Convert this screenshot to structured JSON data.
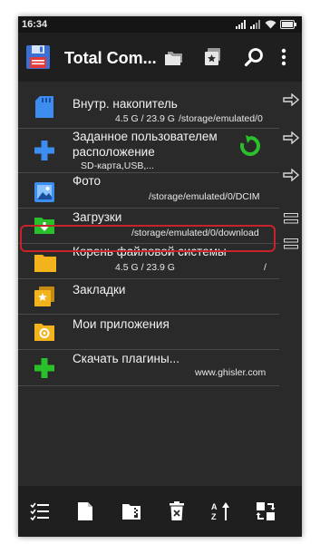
{
  "status_bar": {
    "time": "16:34"
  },
  "app_bar": {
    "title": "Total Com..."
  },
  "items": [
    {
      "name": "Внутр. накопитель",
      "sizes": "4.5 G / 23.9 G",
      "path": "/storage/emulated/0"
    },
    {
      "name": "Заданное пользователем расположение",
      "subtitle": "SD-карта,USB,..."
    },
    {
      "name": "Фото",
      "path": "/storage/emulated/0/DCIM"
    },
    {
      "name": "Загрузки",
      "path": "/storage/emulated/0/download"
    },
    {
      "name": "Корень файловой системы",
      "sizes": "4.5 G / 23.9 G",
      "path": "/"
    },
    {
      "name": "Закладки"
    },
    {
      "name": "Мои приложения"
    },
    {
      "name": "Скачать плагины...",
      "path": "www.ghisler.com"
    }
  ],
  "colors": {
    "background": "#2a2a2a",
    "bar": "#1f1f1f",
    "folder_yellow": "#f3b31c",
    "accent_green": "#29c02b",
    "accent_blue": "#3d8cf0",
    "selection_border": "#c6232a"
  }
}
